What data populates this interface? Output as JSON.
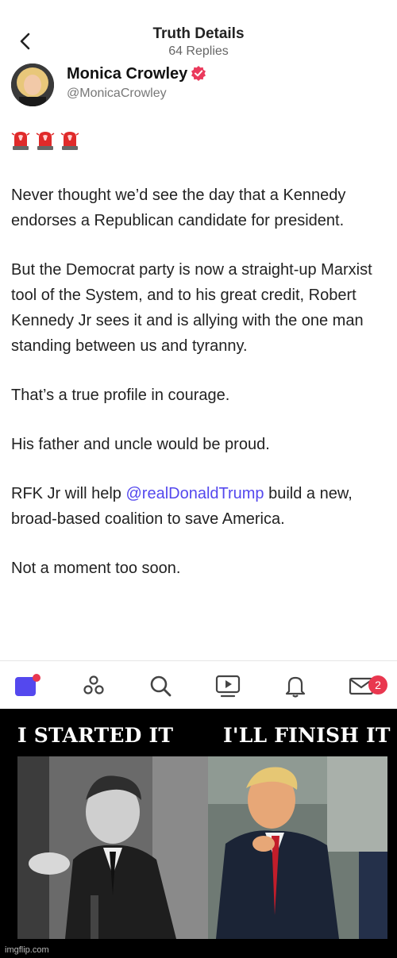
{
  "header": {
    "back_icon": "chevron-left-icon",
    "title": "Truth Details",
    "subtitle": "64 Replies"
  },
  "author": {
    "name": "Monica Crowley",
    "handle": "@MonicaCrowley",
    "verified_icon": "verified-badge-icon",
    "verified_color": "#ea3a5c"
  },
  "post": {
    "emoji": [
      "siren-icon",
      "siren-icon",
      "siren-icon"
    ],
    "paragraphs": [
      "Never thought we’d see the day that a Kennedy endorses a Republican candidate for president.",
      "But the Democrat party is now a straight-up Marxist tool of the System, and to his great credit, Robert Kennedy Jr sees it and is allying with the one man standing between us and tyranny.",
      "That’s a true profile in courage.",
      "His father and uncle would be proud."
    ],
    "p5_before": "RFK Jr will help ",
    "p5_mention": "@realDonaldTrump",
    "p5_after": " build a new, broad-based coalition to save America.",
    "p6": "Not a moment too soon.",
    "mention_color": "#5448ee"
  },
  "tabbar": {
    "tabs": [
      "home-icon",
      "groups-icon",
      "search-icon",
      "video-icon",
      "notifications-icon",
      "messages-icon"
    ],
    "messages_badge": "2",
    "accent": "#5448ee",
    "badge_color": "#e9374f"
  },
  "meme": {
    "caption_left": "I STARTED IT",
    "caption_right": "I'LL FINISH IT",
    "watermark": "imgflip.com"
  }
}
